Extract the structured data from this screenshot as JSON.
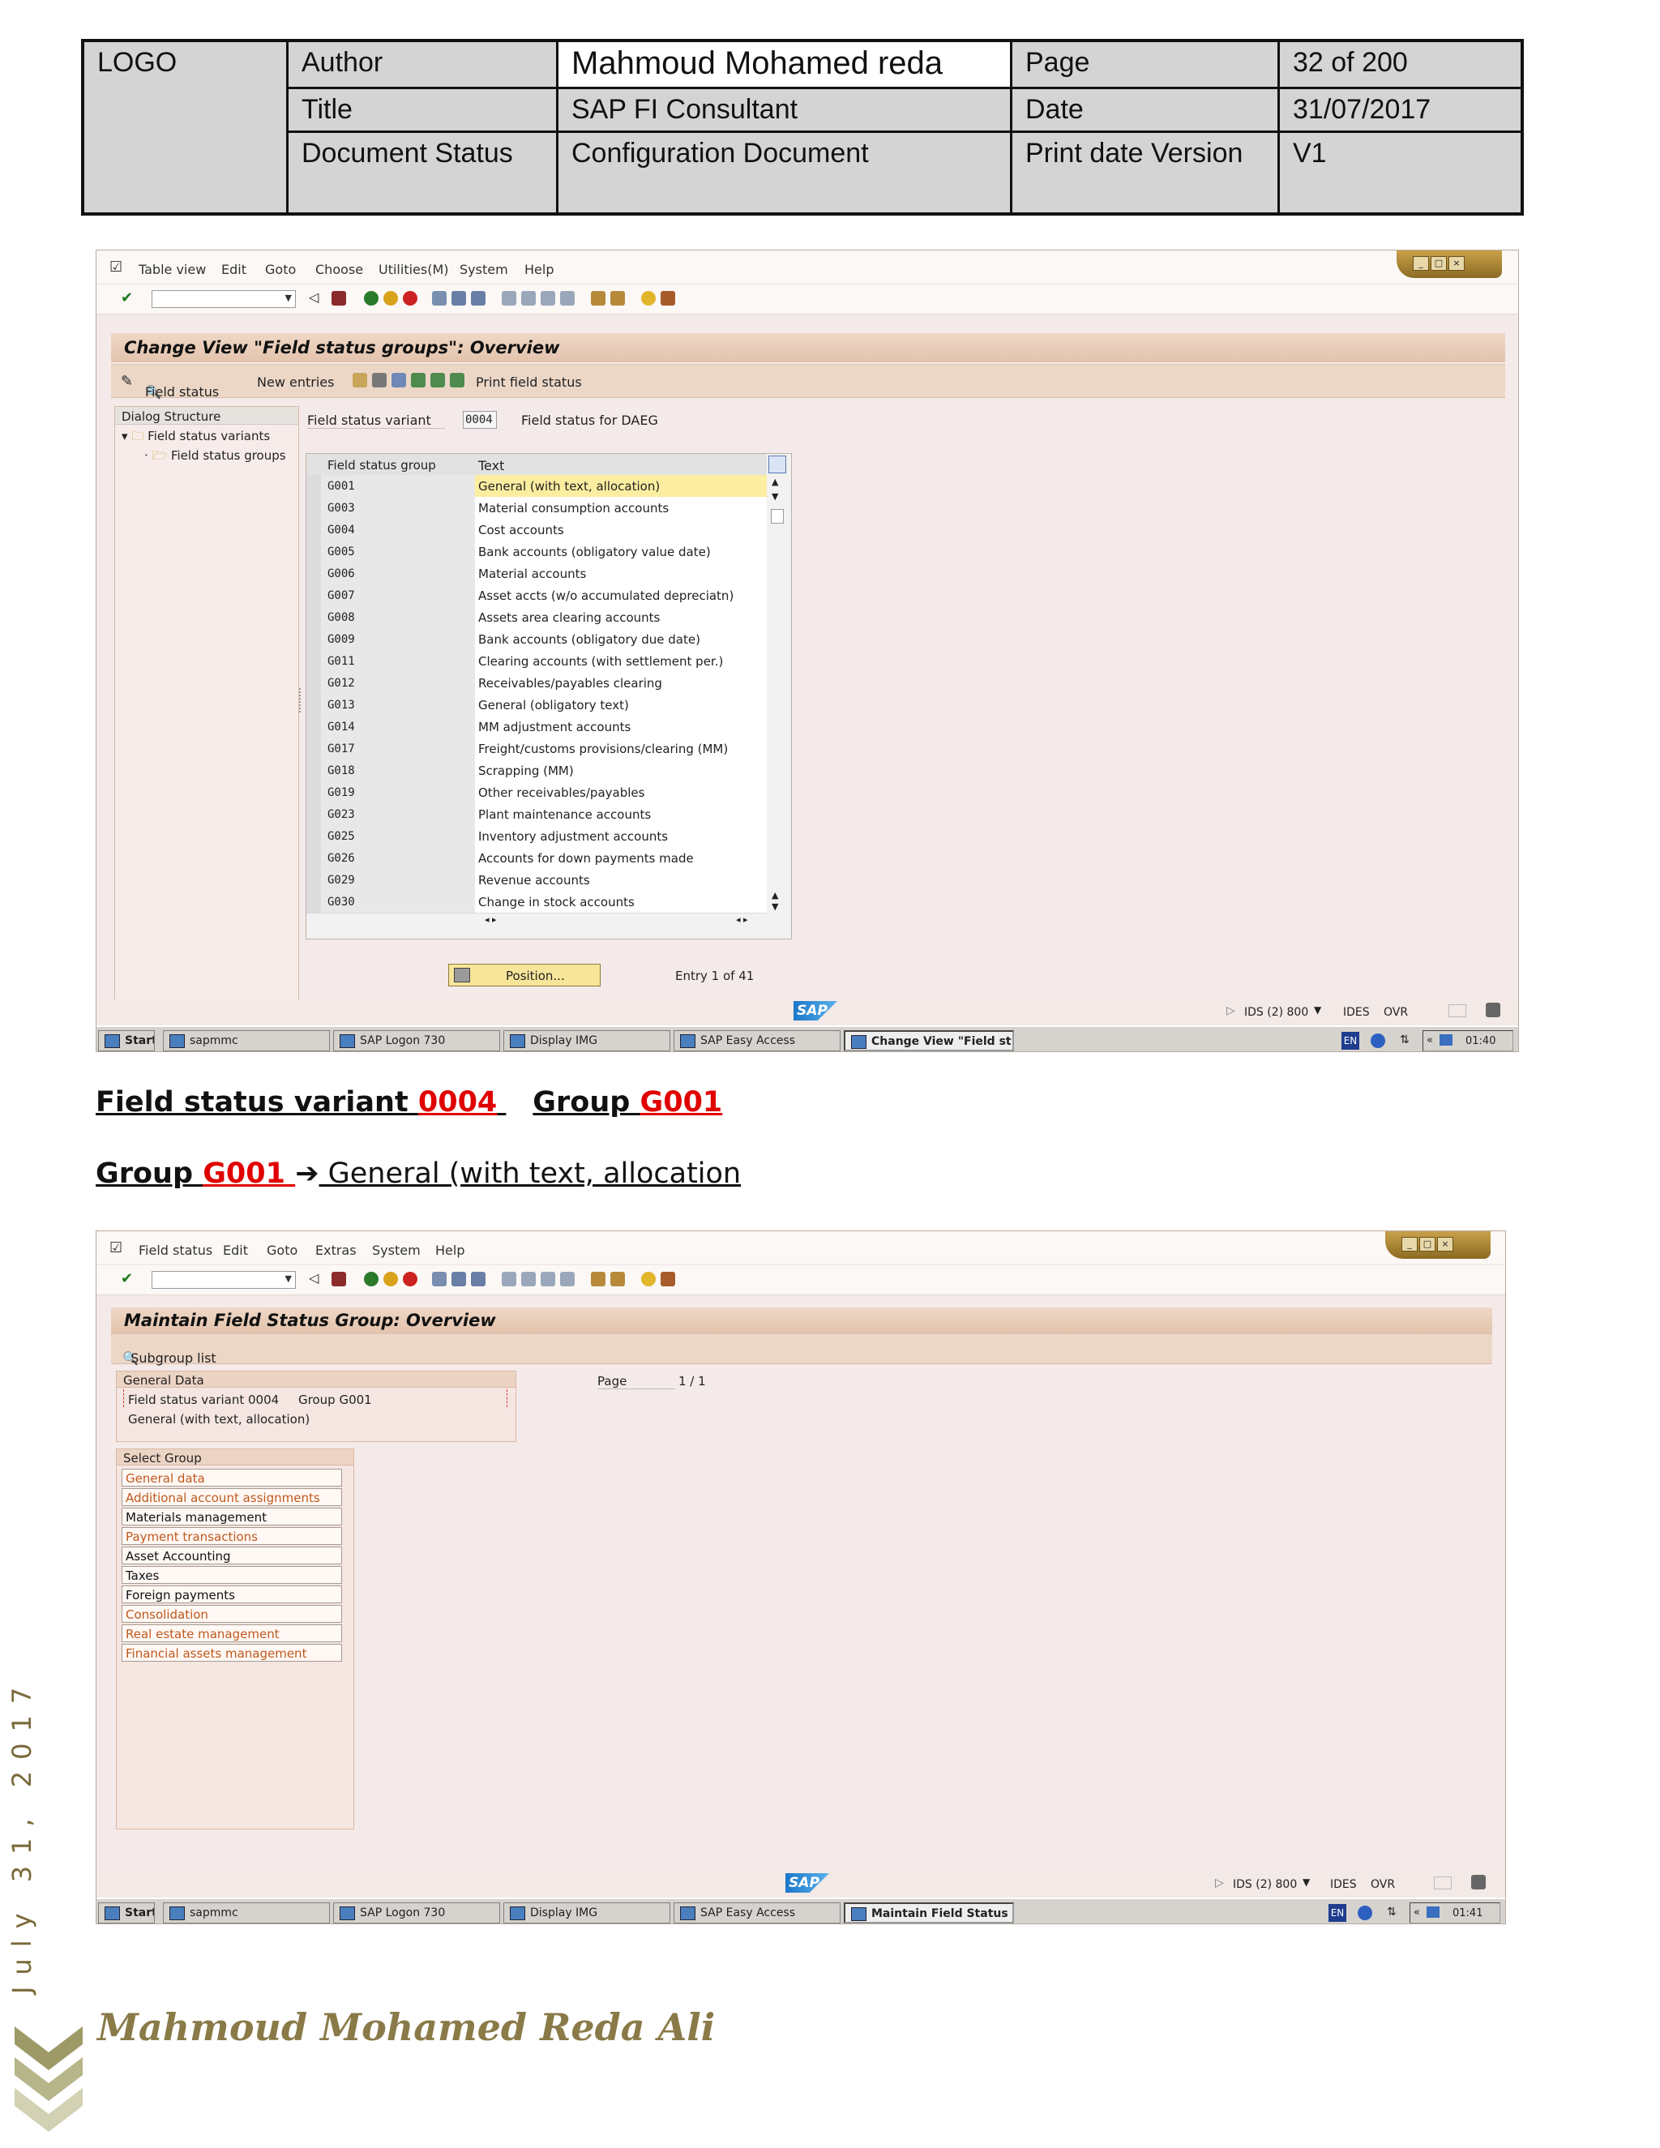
{
  "header": {
    "logo": "LOGO",
    "author_label": "Author",
    "author_value": "Mahmoud Mohamed reda",
    "page_label": "Page",
    "page_value": "32 of 200",
    "title_label": "Title",
    "title_value": "SAP FI Consultant",
    "date_label": "Date",
    "date_value": "31/07/2017",
    "status_label": "Document Status",
    "status_value": "Configuration Document",
    "print_label": "Print date Version",
    "print_value": "V1"
  },
  "win1": {
    "menu": [
      "Table view",
      "Edit",
      "Goto",
      "Choose",
      "Utilities(M)",
      "System",
      "Help"
    ],
    "title": "Change View \"Field status groups\": Overview",
    "app_buttons": {
      "field_status": "Field status",
      "new_entries": "New entries",
      "print_field_status": "Print field status"
    },
    "dialog_structure": "Dialog Structure",
    "tree": [
      "Field status variants",
      "Field status groups"
    ],
    "variant_label": "Field status variant",
    "variant_value": "0004",
    "variant_text": "Field status for DAEG",
    "columns": [
      "Field status group",
      "Text"
    ],
    "rows": [
      [
        "G001",
        "General (with text, allocation)"
      ],
      [
        "G003",
        "Material consumption accounts"
      ],
      [
        "G004",
        "Cost accounts"
      ],
      [
        "G005",
        "Bank accounts (obligatory value date)"
      ],
      [
        "G006",
        "Material accounts"
      ],
      [
        "G007",
        "Asset accts (w/o accumulated depreciatn)"
      ],
      [
        "G008",
        "Assets area clearing accounts"
      ],
      [
        "G009",
        "Bank accounts (obligatory due date)"
      ],
      [
        "G011",
        "Clearing accounts (with settlement per.)"
      ],
      [
        "G012",
        "Receivables/payables clearing"
      ],
      [
        "G013",
        "General (obligatory text)"
      ],
      [
        "G014",
        "MM adjustment accounts"
      ],
      [
        "G017",
        "Freight/customs provisions/clearing (MM)"
      ],
      [
        "G018",
        "Scrapping (MM)"
      ],
      [
        "G019",
        "Other receivables/payables"
      ],
      [
        "G023",
        "Plant maintenance accounts"
      ],
      [
        "G025",
        "Inventory adjustment accounts"
      ],
      [
        "G026",
        "Accounts for down payments made"
      ],
      [
        "G029",
        "Revenue accounts"
      ],
      [
        "G030",
        "Change in stock accounts"
      ]
    ],
    "position_button": "Position...",
    "entry_info": "Entry 1 of 41",
    "status_system": "IDS (2) 800",
    "status_client": "IDES",
    "status_mode": "OVR",
    "taskbar": {
      "start": "Start",
      "t1": "sapmmc",
      "t2": "SAP Logon 730",
      "t3": "Display IMG",
      "t4": "SAP Easy Access",
      "t5": "Change View \"Field st...",
      "lang": "EN",
      "time": "01:40"
    }
  },
  "heading1": {
    "p1": "Field status variant ",
    "p2": "0004",
    "p3": "Group ",
    "p4": "G001"
  },
  "heading2": {
    "p1": "Group ",
    "p2": "G001 ",
    "arrow": "➔",
    "p3": " General (with text, allocation"
  },
  "win2": {
    "menu": [
      "Field status",
      "Edit",
      "Goto",
      "Extras",
      "System",
      "Help"
    ],
    "title": "Maintain Field Status Group: Overview",
    "subgroup_list": "Subgroup list",
    "general_data": "General Data",
    "line1": "Field status variant 0004     Group G001",
    "line2": "General (with text, allocation)",
    "page_label": "Page",
    "page_value": "1 / 1",
    "select_group": "Select Group",
    "groups": [
      "General data",
      "Additional account assignments",
      "Materials management",
      "Payment transactions",
      "Asset Accounting",
      "Taxes",
      "Foreign payments",
      "Consolidation",
      "Real estate management",
      "Financial assets management"
    ],
    "group_colors": [
      "#c0581d",
      "#c0581d",
      "#111111",
      "#c0581d",
      "#111111",
      "#111111",
      "#111111",
      "#c0581d",
      "#c0581d",
      "#c0581d"
    ],
    "status_system": "IDS (2) 800",
    "status_client": "IDES",
    "status_mode": "OVR",
    "taskbar": {
      "start": "Start",
      "t1": "sapmmc",
      "t2": "SAP Logon 730",
      "t3": "Display IMG",
      "t4": "SAP Easy Access",
      "t5": "Maintain Field Status ...",
      "lang": "EN",
      "time": "01:41"
    }
  },
  "footer": {
    "vertical_date": "July 31, 2017",
    "signature": "Mahmoud Mohamed Reda Ali"
  },
  "colors": {
    "accent_red": "#e00000",
    "sap_title": "#e3c3ac",
    "window_bg": "#f5eaea"
  }
}
